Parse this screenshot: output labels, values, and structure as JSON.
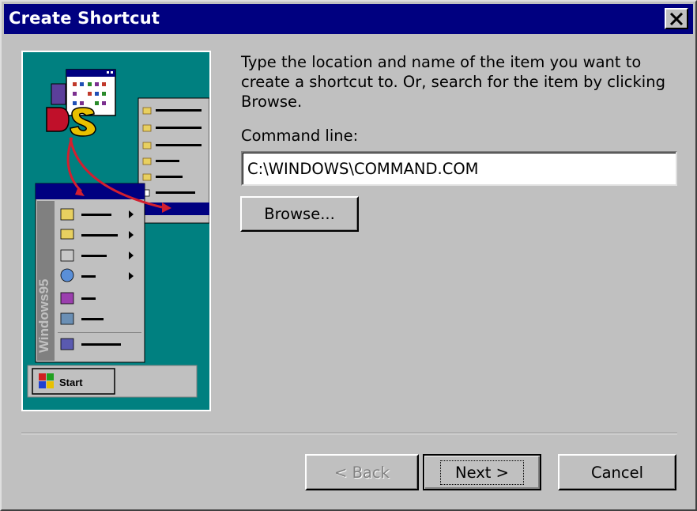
{
  "window": {
    "title": "Create Shortcut"
  },
  "main": {
    "description": "Type the location and name of the item you want to create a shortcut to. Or, search for the item by clicking Browse.",
    "command_label": "Command line:",
    "command_value": "C:\\WINDOWS\\COMMAND.COM"
  },
  "buttons": {
    "browse": "Browse...",
    "back": "< Back",
    "next": "Next >",
    "cancel": "Cancel"
  },
  "illustration": {
    "sidebar_text": "Windows95",
    "start_label": "Start"
  },
  "colors": {
    "titlebar": "#000080",
    "illustration_bg": "#008080",
    "face": "#c0c0c0",
    "arrow": "#d21f2f"
  },
  "icons": {
    "close": "close-icon",
    "illustration": "start-menu-shortcut-illustration"
  }
}
